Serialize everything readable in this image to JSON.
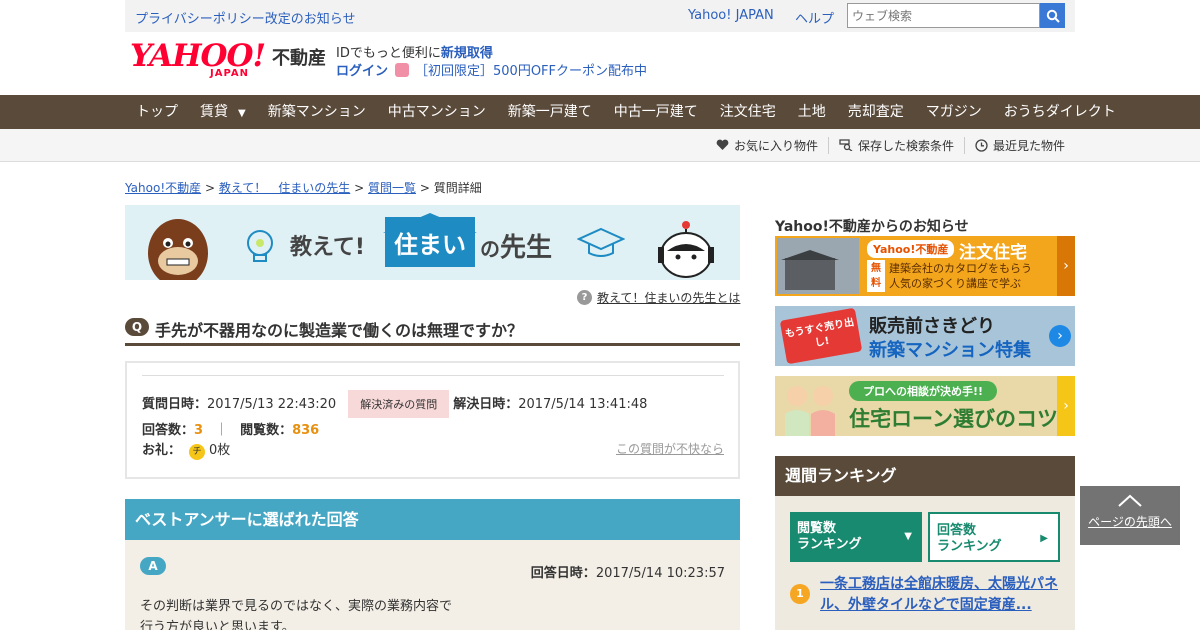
{
  "topbar": {
    "notice": "プライバシーポリシー改定のお知らせ",
    "yahoo_japan": "Yahoo! JAPAN",
    "help": "ヘルプ",
    "search_placeholder": "ウェブ検索"
  },
  "header": {
    "logo_text": "YAHOO!",
    "logo_japan": "JAPAN",
    "logo_fudosan": "不動産",
    "id_prefix": "IDでもっと便利に",
    "id_signup": "新規取得",
    "login": "ログイン",
    "coupon": "［初回限定］500円OFFクーポン配布中"
  },
  "nav": {
    "items": [
      "トップ",
      "賃貸",
      "新築マンション",
      "中古マンション",
      "新築一戸建て",
      "中古一戸建て",
      "注文住宅",
      "土地",
      "売却査定",
      "マガジン",
      "おうちダイレクト"
    ],
    "dropdown_marker": "▼"
  },
  "subnav": {
    "favorites": "お気に入り物件",
    "saved_search": "保存した検索条件",
    "recent": "最近見た物件"
  },
  "breadcrumb": {
    "home": "Yahoo!不動産",
    "sensei": "教えて！　住まいの先生",
    "list": "質問一覧",
    "current": "質問詳細",
    "sep": ">"
  },
  "banner": {
    "oshiete": "教えて!",
    "sumai": "住まい",
    "no": "の",
    "sensei": "先生",
    "about_link": "教えて！住まいの先生とは"
  },
  "question": {
    "badge": "Q",
    "title": "手先が不器用なのに製造業で働くのは無理ですか？",
    "asked_label": "質問日時：",
    "asked_value": "2017/5/13 22:43:20",
    "status": "解決済みの質問",
    "resolved_label": "解決日時：",
    "resolved_value": "2017/5/14 13:41:48",
    "answers_label": "回答数：",
    "answers_value": "3",
    "sep": "｜",
    "views_label": "閲覧数：",
    "views_value": "836",
    "thanks_label": "お礼：",
    "thanks_chip": "チ",
    "thanks_value": "0枚",
    "report": "この質問が不快なら"
  },
  "best_answer": {
    "heading": "ベストアンサーに選ばれた回答",
    "badge": "A",
    "date_label": "回答日時：",
    "date_value": "2017/5/14 10:23:57",
    "body_line1": "その判断は業界で見るのではなく、実際の業務内容で",
    "body_line2": "行う方が良いと思います。"
  },
  "sidebar": {
    "news_title": "Yahoo!不動産からのお知らせ",
    "ads": [
      {
        "tag": "Yahoo!不動産",
        "title": "注文住宅",
        "badge": "無料",
        "line1": "建築会社のカタログをもらう",
        "line2": "人気の家づくり講座で学ぶ"
      },
      {
        "burst": "もうすぐ売り出し!",
        "line1": "販売前さきどり",
        "line2": "新築マンション特集"
      },
      {
        "tag": "プロへの相談が決め手!!",
        "title": "住宅ローン選びのコツ"
      }
    ],
    "ranking_title": "週間ランキング",
    "tab1": "閲覧数\nランキング",
    "tab1_l1": "閲覧数",
    "tab1_l2": "ランキング",
    "tab2_l1": "回答数",
    "tab2_l2": "ランキング",
    "item1_num": "1",
    "item1_text": "一条工務店は全館床暖房、太陽光パネル、外壁タイルなどで固定資産..."
  },
  "to_top": "ページの先頭へ"
}
